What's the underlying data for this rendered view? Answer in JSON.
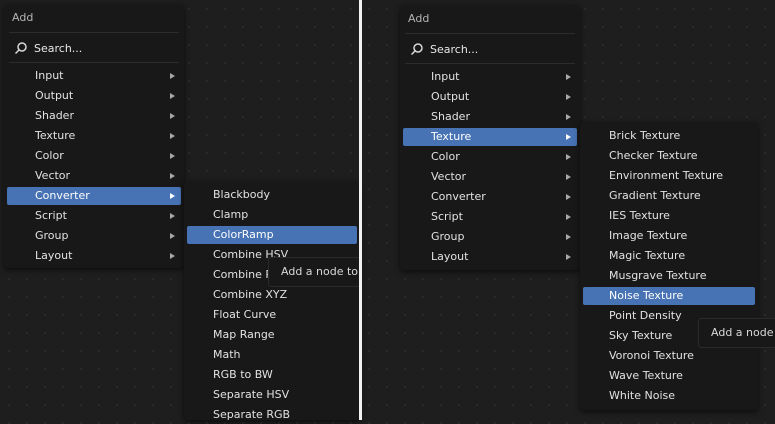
{
  "left": {
    "menu_title": "Add",
    "search_label": "Search...",
    "items": [
      "Input",
      "Output",
      "Shader",
      "Texture",
      "Color",
      "Vector",
      "Converter",
      "Script",
      "Group",
      "Layout"
    ],
    "active_item": "Converter",
    "submenu": [
      "Blackbody",
      "Clamp",
      "ColorRamp",
      "Combine HSV",
      "Combine RGB",
      "Combine XYZ",
      "Float Curve",
      "Map Range",
      "Math",
      "RGB to BW",
      "Separate HSV",
      "Separate RGB"
    ],
    "active_sub": "ColorRamp",
    "tooltip": "Add a node to the acti"
  },
  "right": {
    "menu_title": "Add",
    "search_label": "Search...",
    "items": [
      "Input",
      "Output",
      "Shader",
      "Texture",
      "Color",
      "Vector",
      "Converter",
      "Script",
      "Group",
      "Layout"
    ],
    "active_item": "Texture",
    "submenu": [
      "Brick Texture",
      "Checker Texture",
      "Environment Texture",
      "Gradient Texture",
      "IES Texture",
      "Image Texture",
      "Magic Texture",
      "Musgrave Texture",
      "Noise Texture",
      "Point Density",
      "Sky Texture",
      "Voronoi Texture",
      "Wave Texture",
      "White Noise"
    ],
    "active_sub": "Noise Texture",
    "tooltip": "Add a node to"
  },
  "colors": {
    "accent": "#4772b3",
    "panel": "#181818",
    "background": "#1e1e1e"
  },
  "icons": {
    "search": "magnifier-icon",
    "submenu_arrow": "triangle-right-icon"
  }
}
